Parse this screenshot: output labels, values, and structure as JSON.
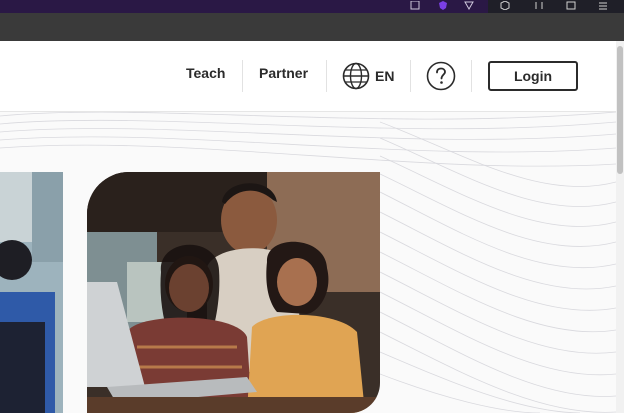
{
  "nav": {
    "teach": "Teach",
    "partner": "Partner",
    "language": "EN",
    "login": "Login"
  },
  "icons": {
    "globe": "globe-icon",
    "help": "question-circle-icon"
  },
  "colors": {
    "os_bar": "#2a1845",
    "tab_strip": "#3a3a3a",
    "text": "#2b2b2b",
    "divider": "#e2e2e2"
  }
}
